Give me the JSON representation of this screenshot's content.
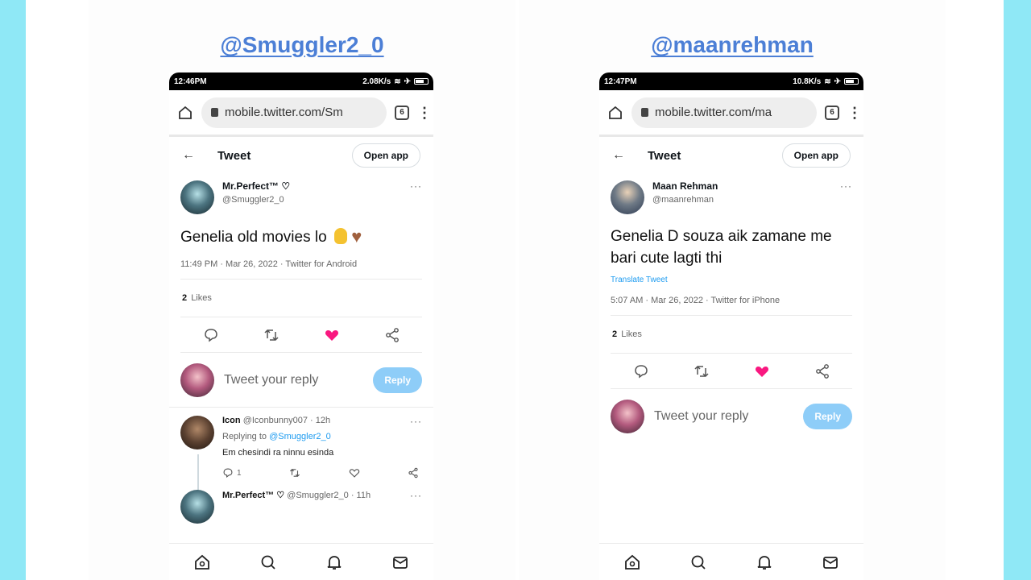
{
  "left": {
    "handle": "@Smuggler2_0",
    "status": {
      "time": "12:46PM",
      "speed": "2.08K/s"
    },
    "url": "mobile.twitter.com/Sm",
    "tab_count": "6",
    "header": {
      "title": "Tweet",
      "open_app": "Open app"
    },
    "tweet": {
      "name": "Mr.Perfect™ ♡",
      "handle": "@Smuggler2_0",
      "text": "Genelia old movies lo",
      "meta": "11:49 PM · Mar 26, 2022 · Twitter for Android",
      "likes_count": "2",
      "likes_label": "Likes"
    },
    "reply_box": {
      "placeholder": "Tweet your reply",
      "button": "Reply"
    },
    "comments": [
      {
        "name": "Icon",
        "sub": "@Iconbunny007 · 12h",
        "replying_prefix": "Replying to",
        "replying_to": "@Smuggler2_0",
        "text": "Em chesindi ra ninnu esinda",
        "reply_count": "1"
      },
      {
        "name": "Mr.Perfect™ ♡",
        "sub": "@Smuggler2_0 · 11h"
      }
    ]
  },
  "right": {
    "handle": "@maanrehman",
    "status": {
      "time": "12:47PM",
      "speed": "10.8K/s"
    },
    "url": "mobile.twitter.com/ma",
    "tab_count": "6",
    "header": {
      "title": "Tweet",
      "open_app": "Open app"
    },
    "tweet": {
      "name": "Maan Rehman",
      "handle": "@maanrehman",
      "text": "Genelia D souza aik zamane me bari cute lagti thi",
      "translate": "Translate Tweet",
      "meta": "5:07 AM · Mar 26, 2022 · Twitter for iPhone",
      "likes_count": "2",
      "likes_label": "Likes"
    },
    "reply_box": {
      "placeholder": "Tweet your reply",
      "button": "Reply"
    }
  },
  "colors": {
    "page_bg": "#8fe8f6",
    "handle": "#4c7fd6",
    "like": "#f91880",
    "reply_btn": "#8ecdf8",
    "link": "#1d9bf0"
  }
}
